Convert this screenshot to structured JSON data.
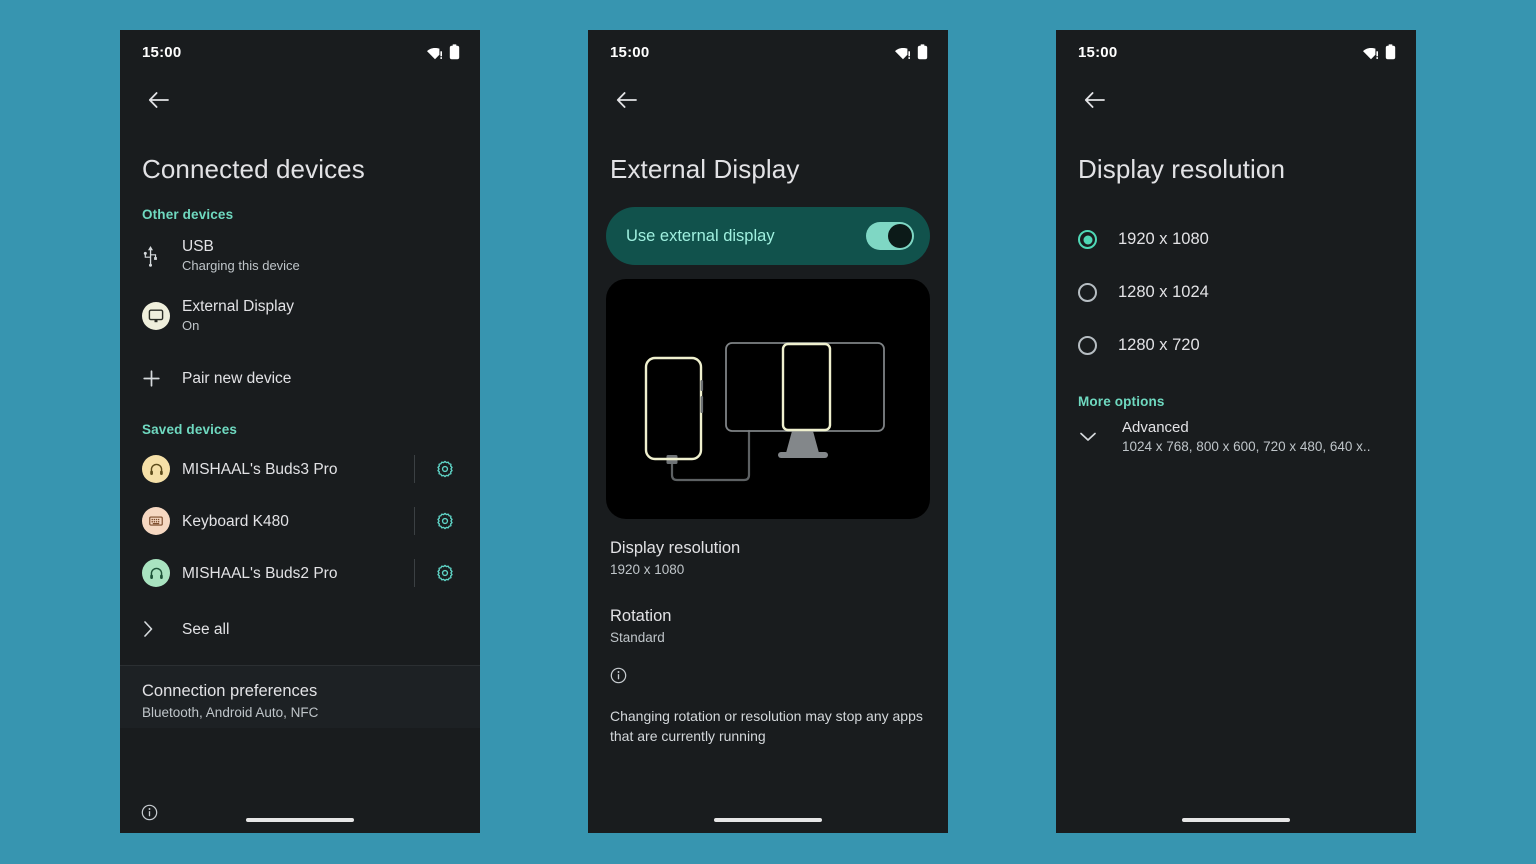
{
  "theme": {
    "page_background": "#3795b0",
    "panel_background": "#191c1e",
    "accent_teal": "#6fd9c0",
    "toggle_banner_background": "#11524c",
    "toggle_track": "#7fd7c4",
    "radio_selected": "#4fd8b6",
    "illustration_background": "#000000",
    "illustration_stroke": "#eff0ce"
  },
  "status_bar": {
    "time": "15:00",
    "icons": [
      "wifi-no-internet-icon",
      "battery-icon"
    ]
  },
  "panels": [
    {
      "id": "connected-devices",
      "title": "Connected devices",
      "back_icon": "back-arrow-icon",
      "sections": [
        {
          "header": "Other devices",
          "rows": [
            {
              "icon": "usb-icon",
              "icon_style": "plain",
              "title": "USB",
              "subtitle": "Charging this device"
            },
            {
              "icon": "monitor-icon",
              "icon_style": "circle",
              "icon_bg": "#efefdc",
              "title": "External Display",
              "subtitle": "On"
            },
            {
              "icon": "plus-icon",
              "icon_style": "plain",
              "title": "Pair new device",
              "subtitle": ""
            }
          ]
        },
        {
          "header": "Saved devices",
          "rows": [
            {
              "icon": "headphones-icon",
              "icon_style": "avatar",
              "icon_bg": "#f5e0a8",
              "icon_fg": "#5c4b1b",
              "title": "MISHAAL's Buds3 Pro",
              "subtitle": "",
              "trailing_icon": "gear-icon"
            },
            {
              "icon": "keyboard-icon",
              "icon_style": "avatar",
              "icon_bg": "#f6d8c2",
              "icon_fg": "#7a4a2a",
              "title": "Keyboard K480",
              "subtitle": "",
              "trailing_icon": "gear-icon"
            },
            {
              "icon": "headphones-icon",
              "icon_style": "avatar",
              "icon_bg": "#a9e3c0",
              "icon_fg": "#1d5338",
              "title": "MISHAAL's Buds2 Pro",
              "subtitle": "",
              "trailing_icon": "gear-icon"
            },
            {
              "icon": "chevron-right-icon",
              "icon_style": "plain",
              "title": "See all",
              "subtitle": ""
            }
          ]
        }
      ],
      "footer_row": {
        "title": "Connection preferences",
        "subtitle": "Bluetooth, Android Auto, NFC"
      },
      "corner_icon": "info-icon"
    },
    {
      "id": "external-display",
      "title": "External Display",
      "back_icon": "back-arrow-icon",
      "toggle": {
        "label": "Use external display",
        "state": "on"
      },
      "illustration": {
        "name": "phone-to-monitor-mirroring-illustration",
        "elements": [
          "phone-outline",
          "cable",
          "monitor-outline",
          "monitor-stand",
          "mirrored-portrait-window"
        ]
      },
      "details": [
        {
          "title": "Display resolution",
          "subtitle": "1920 x 1080"
        },
        {
          "title": "Rotation",
          "subtitle": "Standard"
        }
      ],
      "note": {
        "icon": "info-icon",
        "text": "Changing rotation or resolution may stop any apps that are currently running"
      }
    },
    {
      "id": "display-resolution",
      "title": "Display resolution",
      "back_icon": "back-arrow-icon",
      "options": [
        {
          "label": "1920 x 1080",
          "selected": true
        },
        {
          "label": "1280 x 1024",
          "selected": false
        },
        {
          "label": "1280 x 720",
          "selected": false
        }
      ],
      "more_options_header": "More options",
      "advanced": {
        "icon": "chevron-down-icon",
        "title": "Advanced",
        "subtitle": "1024 x 768, 800 x 600, 720 x 480, 640 x.."
      }
    }
  ]
}
